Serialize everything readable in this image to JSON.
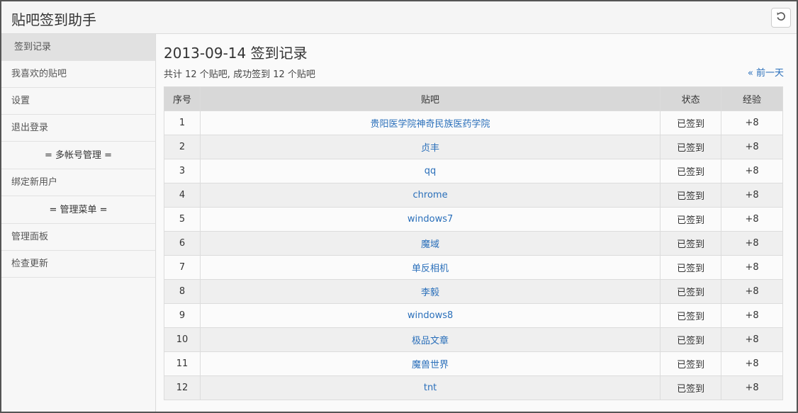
{
  "app": {
    "title": "贴吧签到助手"
  },
  "sidebar": {
    "items": [
      {
        "label": "签到记录"
      },
      {
        "label": "我喜欢的贴吧"
      },
      {
        "label": "设置"
      },
      {
        "label": "退出登录"
      }
    ],
    "section1": "= 多帐号管理 =",
    "items2": [
      {
        "label": "绑定新用户"
      }
    ],
    "section2": "= 管理菜单 =",
    "items3": [
      {
        "label": "管理面板"
      },
      {
        "label": "检查更新"
      }
    ]
  },
  "main": {
    "title": "2013-09-14 签到记录",
    "summary": "共计 12 个贴吧, 成功签到 12 个贴吧",
    "prev_label": "« 前一天",
    "columns": [
      "序号",
      "贴吧",
      "状态",
      "经验"
    ],
    "rows": [
      [
        "1",
        "贵阳医学院神奇民族医药学院",
        "已签到",
        "+8"
      ],
      [
        "2",
        "贞丰",
        "已签到",
        "+8"
      ],
      [
        "3",
        "qq",
        "已签到",
        "+8"
      ],
      [
        "4",
        "chrome",
        "已签到",
        "+8"
      ],
      [
        "5",
        "windows7",
        "已签到",
        "+8"
      ],
      [
        "6",
        "魔域",
        "已签到",
        "+8"
      ],
      [
        "7",
        "单反相机",
        "已签到",
        "+8"
      ],
      [
        "8",
        "李毅",
        "已签到",
        "+8"
      ],
      [
        "9",
        "windows8",
        "已签到",
        "+8"
      ],
      [
        "10",
        "极品文章",
        "已签到",
        "+8"
      ],
      [
        "11",
        "魔兽世界",
        "已签到",
        "+8"
      ],
      [
        "12",
        "tnt",
        "已签到",
        "+8"
      ]
    ]
  },
  "colors": {
    "link": "#2a6fba",
    "active_bg": "#e1e1e1"
  },
  "icons": {
    "refresh": "refresh-icon"
  }
}
